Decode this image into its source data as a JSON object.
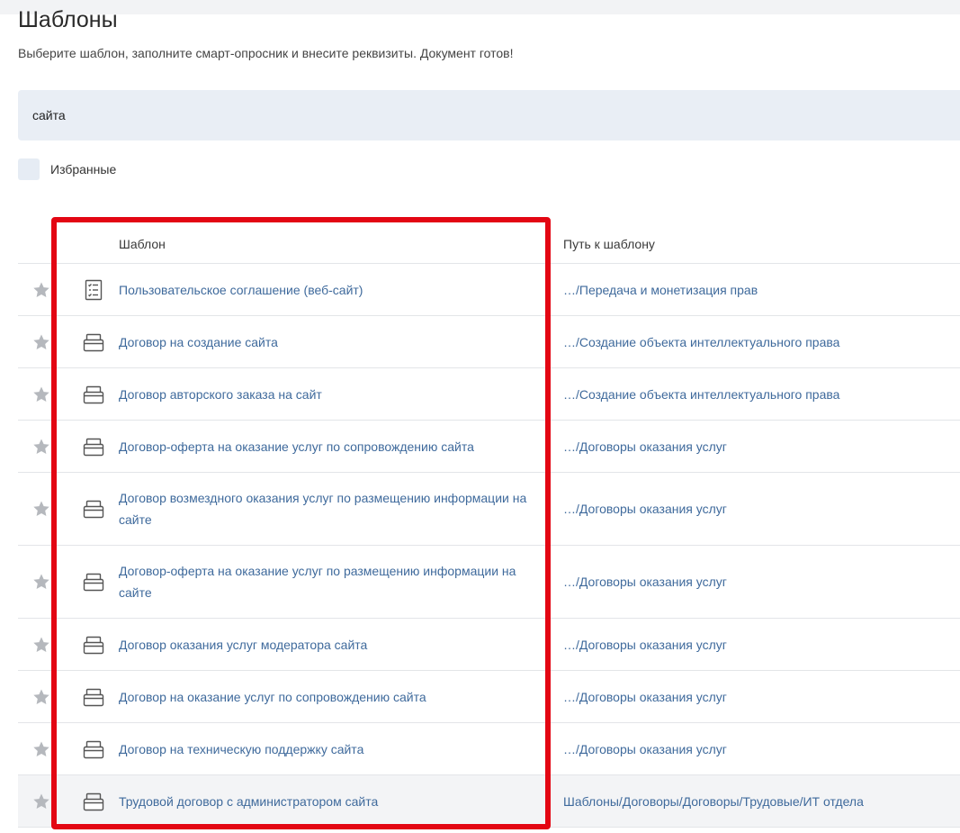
{
  "header": {
    "title": "Шаблоны",
    "subtitle": "Выберите шаблон, заполните смарт-опросник и внесите реквизиты. Документ готов!"
  },
  "search": {
    "value": "сайта"
  },
  "favorites": {
    "label": "Избранные",
    "checked": false
  },
  "table": {
    "columns": {
      "template": "Шаблон",
      "path": "Путь к шаблону"
    },
    "rows": [
      {
        "icon": "checklist-document-icon",
        "name": "Пользовательское соглашение (веб-сайт)",
        "path": "…/Передача и монетизация прав",
        "lines": 1,
        "highlighted": false
      },
      {
        "icon": "folder-box-icon",
        "name": "Договор на создание сайта",
        "path": "…/Создание объекта интеллектуального права",
        "lines": 1,
        "highlighted": false
      },
      {
        "icon": "folder-box-icon",
        "name": "Договор авторского заказа на сайт",
        "path": "…/Создание объекта интеллектуального права",
        "lines": 1,
        "highlighted": false
      },
      {
        "icon": "folder-box-icon",
        "name": "Договор-оферта на оказание услуг по сопровождению сайта",
        "path": "…/Договоры оказания услуг",
        "lines": 1,
        "highlighted": false
      },
      {
        "icon": "folder-box-icon",
        "name": "Договор возмездного оказания услуг по размещению информации на сайте",
        "path": "…/Договоры оказания услуг",
        "lines": 2,
        "highlighted": false
      },
      {
        "icon": "folder-box-icon",
        "name": "Договор-оферта на оказание услуг по размещению информации на сайте",
        "path": "…/Договоры оказания услуг",
        "lines": 2,
        "highlighted": false
      },
      {
        "icon": "folder-box-icon",
        "name": "Договор оказания услуг модератора сайта",
        "path": "…/Договоры оказания услуг",
        "lines": 1,
        "highlighted": false
      },
      {
        "icon": "folder-box-icon",
        "name": "Договор на оказание услуг по сопровождению сайта",
        "path": "…/Договоры оказания услуг",
        "lines": 1,
        "highlighted": false
      },
      {
        "icon": "folder-box-icon",
        "name": "Договор на техническую поддержку сайта",
        "path": "…/Договоры оказания услуг",
        "lines": 1,
        "highlighted": false
      },
      {
        "icon": "folder-box-icon",
        "name": "Трудовой договор с администратором сайта",
        "path": "Шаблоны/Договоры/Договоры/Трудовые/ИТ отдела",
        "lines": 1,
        "highlighted": true
      }
    ]
  },
  "colors": {
    "link": "#3f6a9c",
    "annotation_frame": "#e30613",
    "search_bg": "#e9eef5",
    "star": "#b5b8bd"
  }
}
